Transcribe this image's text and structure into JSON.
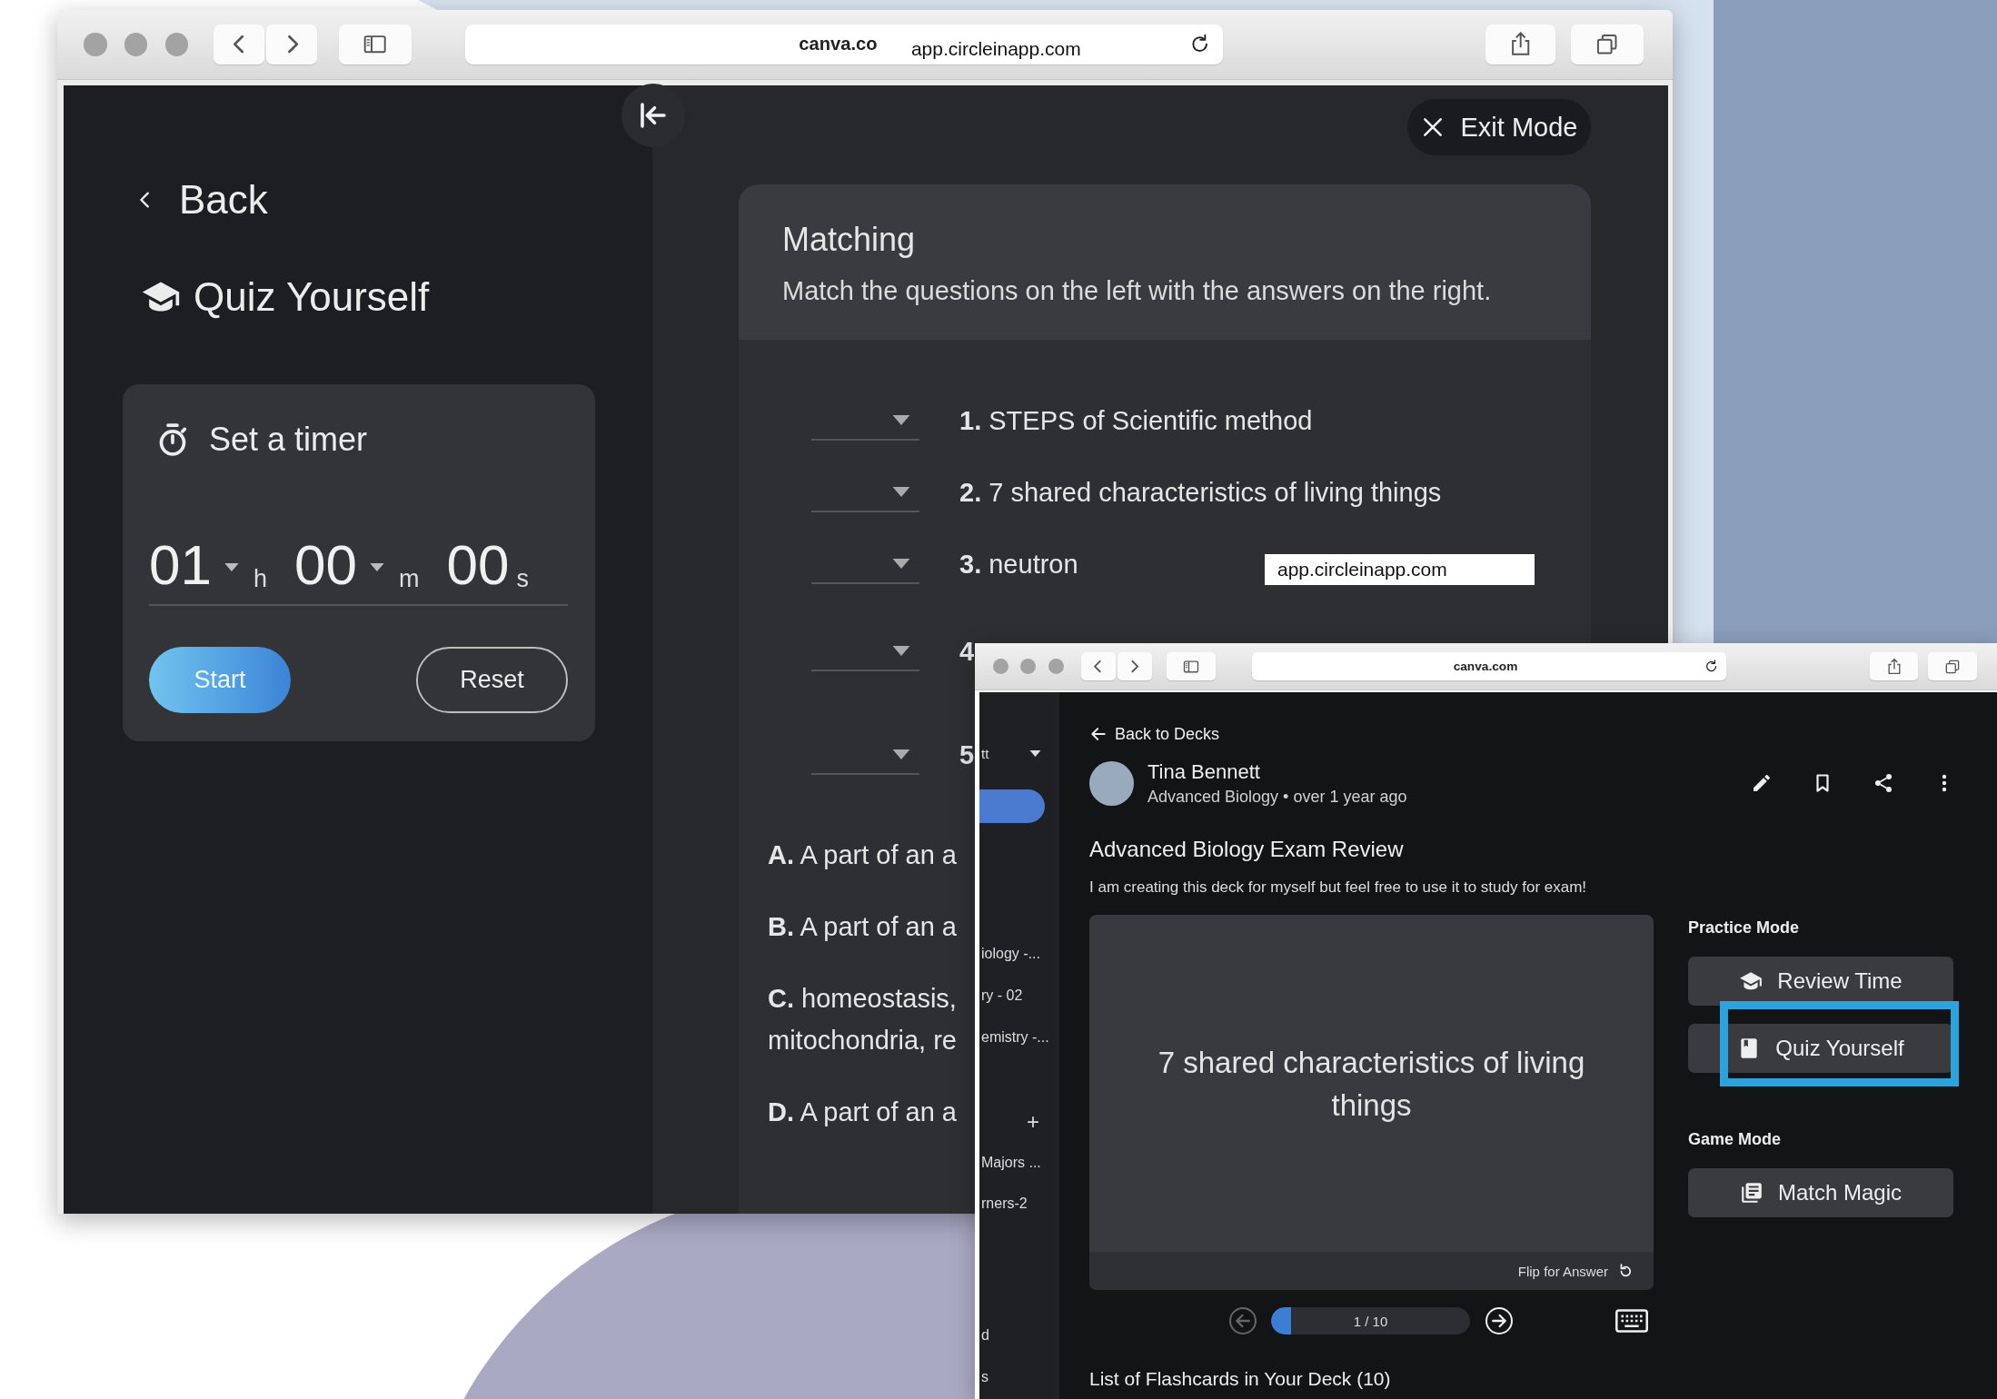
{
  "quiz_window": {
    "browser": {
      "address": "canva.co",
      "address_overlay": "app.circleinapp.com"
    },
    "sidebar": {
      "back": "Back",
      "title": "Quiz Yourself",
      "timer": {
        "title": "Set a timer",
        "fields": [
          {
            "value": "01",
            "unit": "h",
            "kind": "select"
          },
          {
            "value": "00",
            "unit": "m",
            "kind": "select"
          },
          {
            "value": "00",
            "unit": "s",
            "kind": "text"
          }
        ],
        "buttons": [
          {
            "label": "Start",
            "kind": "primary"
          },
          {
            "label": "Reset",
            "kind": "outline"
          }
        ]
      }
    },
    "exit_button": "Exit Mode",
    "matching": {
      "title": "Matching",
      "instructions": "Match the questions on the left with the answers on the right.",
      "questions": [
        {
          "number": "1.",
          "text": "STEPS of Scientific method"
        },
        {
          "number": "2.",
          "text": "7 shared characteristics of living things"
        },
        {
          "number": "3.",
          "text": "neutron"
        },
        {
          "number": "4"
        },
        {
          "number": "5"
        }
      ],
      "answers": [
        {
          "letter": "A.",
          "text": "A part of an a"
        },
        {
          "letter": "B.",
          "text": "A part of an a"
        },
        {
          "letter": "C.",
          "text": "homeostasis, mitochondria, re"
        },
        {
          "letter": "D.",
          "text": "A part of an a"
        }
      ]
    },
    "url_overlay": "app.circleinapp.com"
  },
  "deck_window": {
    "browser": {
      "address": "canva.com"
    },
    "sidebar": {
      "account": "tt",
      "nav": [
        {
          "selected": true
        }
      ],
      "decks": [
        "iology -...",
        "ry - 02",
        "emistry -..."
      ],
      "add": "+",
      "groups": [
        "Majors ...",
        "rners-2"
      ],
      "footer": [
        "d",
        "s"
      ]
    },
    "back": "Back to Decks",
    "author": {
      "name": "Tina Bennett",
      "subtitle": "Advanced Biology • over 1 year ago"
    },
    "title": "Advanced Biology Exam Review",
    "description": "I am creating this deck for myself but feel free to use it to study for exam!",
    "flashcard": {
      "text": "7 shared characteristics of living things",
      "flip": "Flip for Answer"
    },
    "progress": {
      "label": "1 / 10",
      "level": 0.1
    },
    "list_heading": "List of Flashcards in Your Deck (10)",
    "modes": [
      {
        "heading": "Practice Mode",
        "buttons": [
          {
            "label": "Review Time",
            "kind": "review",
            "highlighted": false
          },
          {
            "label": "Quiz Yourself",
            "kind": "quiz",
            "highlighted": true
          }
        ]
      },
      {
        "heading": "Game Mode",
        "buttons": [
          {
            "label": "Match Magic",
            "kind": "game",
            "highlighted": false
          }
        ]
      }
    ]
  }
}
